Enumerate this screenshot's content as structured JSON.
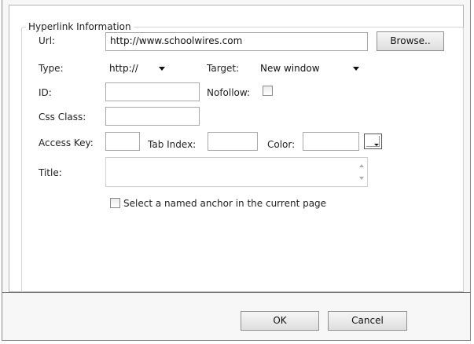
{
  "section": {
    "legend": "Hyperlink Information"
  },
  "url": {
    "label": "Url:",
    "value": "http://www.schoolwires.com",
    "browse_label": "Browse.."
  },
  "type": {
    "label": "Type:",
    "value": "http://"
  },
  "target": {
    "label": "Target:",
    "value": "New window"
  },
  "id_field": {
    "label": "ID:",
    "value": ""
  },
  "nofollow": {
    "label": "Nofollow:",
    "checked": false
  },
  "css_class": {
    "label": "Css Class:",
    "value": ""
  },
  "access_key": {
    "label": "Access Key:",
    "value": ""
  },
  "tab_index": {
    "label": "Tab Index:",
    "value": ""
  },
  "color": {
    "label": "Color:",
    "value": ""
  },
  "title_field": {
    "label": "Title:",
    "value": ""
  },
  "anchor": {
    "label": "Select a named anchor in the current page",
    "checked": false
  },
  "footer": {
    "ok_label": "OK",
    "cancel_label": "Cancel"
  }
}
